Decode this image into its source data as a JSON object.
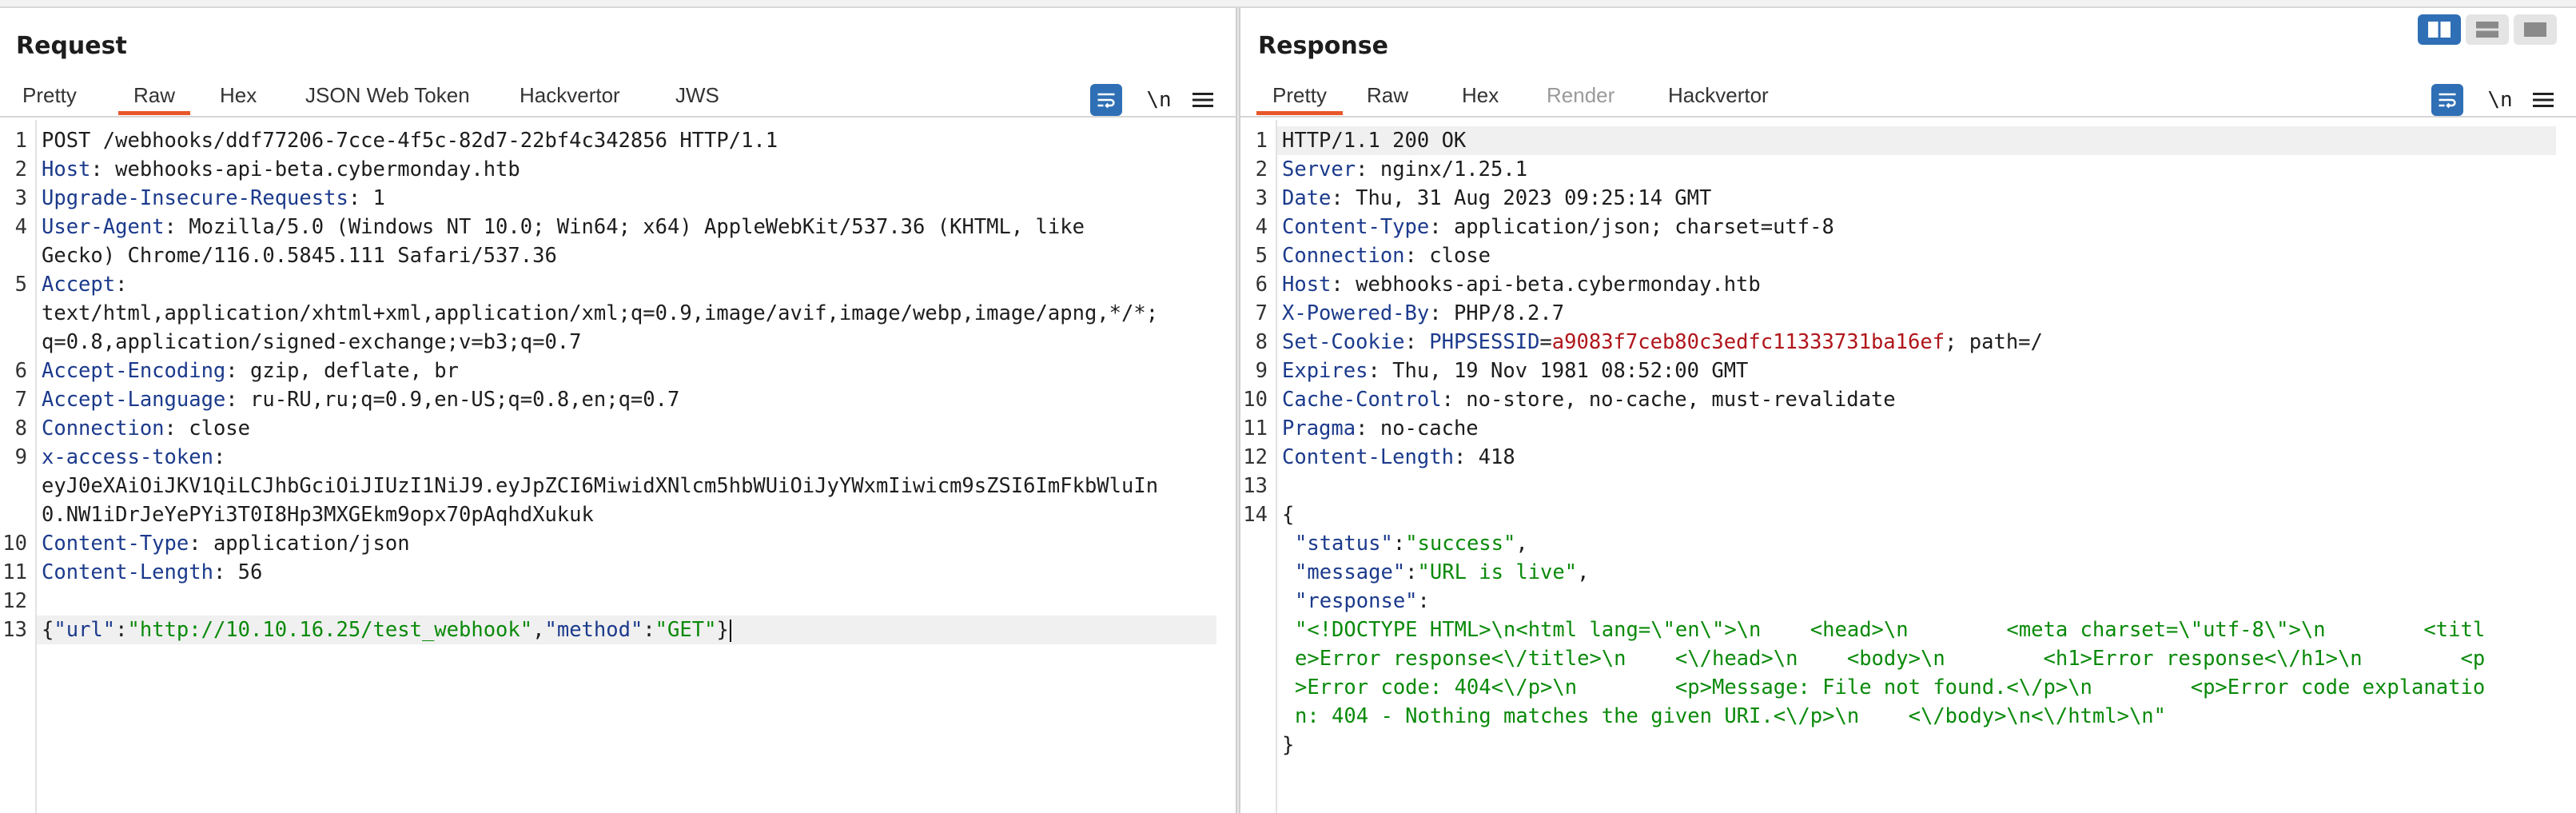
{
  "request": {
    "title": "Request",
    "tabs": [
      {
        "label": "Pretty",
        "active": false
      },
      {
        "label": "Raw",
        "active": true
      },
      {
        "label": "Hex",
        "active": false
      },
      {
        "label": "JSON Web Token",
        "active": false
      },
      {
        "label": "Hackvertor",
        "active": false
      },
      {
        "label": "JWS",
        "active": false
      }
    ],
    "newline_label": "\\n",
    "lines": [
      {
        "n": "1",
        "text": "POST /webhooks/ddf77206-7cce-4f5c-82d7-22bf4c342856 HTTP/1.1"
      },
      {
        "n": "2",
        "key": "Host",
        "value": " webhooks-api-beta.cybermonday.htb"
      },
      {
        "n": "3",
        "key": "Upgrade-Insecure-Requests",
        "value": " 1"
      },
      {
        "n": "4",
        "key": "User-Agent",
        "value": " Mozilla/5.0 (Windows NT 10.0; Win64; x64) AppleWebKit/537.36 (KHTML, like",
        "cont": "Gecko) Chrome/116.0.5845.111 Safari/537.36"
      },
      {
        "n": "5",
        "key": "Accept",
        "value": "",
        "cont": "text/html,application/xhtml+xml,application/xml;q=0.9,image/avif,image/webp,image/apng,*/*;",
        "cont2": "q=0.8,application/signed-exchange;v=b3;q=0.7"
      },
      {
        "n": "6",
        "key": "Accept-Encoding",
        "value": " gzip, deflate, br"
      },
      {
        "n": "7",
        "key": "Accept-Language",
        "value": " ru-RU,ru;q=0.9,en-US;q=0.8,en;q=0.7"
      },
      {
        "n": "8",
        "key": "Connection",
        "value": " close"
      },
      {
        "n": "9",
        "key": "x-access-token",
        "value": "",
        "cont": "eyJ0eXAiOiJKV1QiLCJhbGciOiJIUzI1NiJ9.eyJpZCI6MiwidXNlcm5hbWUiOiJyYWxmIiwicm9sZSI6ImFkbWluIn",
        "cont2": "0.NW1iDrJeYePYi3T0I8Hp3MXGEkm9opx70pAqhdXukuk"
      },
      {
        "n": "10",
        "key": "Content-Type",
        "value": " application/json"
      },
      {
        "n": "11",
        "key": "Content-Length",
        "value": " 56"
      },
      {
        "n": "12"
      },
      {
        "n": "13",
        "body": {
          "k1": "\"url\"",
          "v1": "\"http://10.10.16.25/test_webhook\"",
          "k2": "\"method\"",
          "v2": "\"GET\""
        }
      }
    ]
  },
  "response": {
    "title": "Response",
    "tabs": [
      {
        "label": "Pretty",
        "active": true
      },
      {
        "label": "Raw",
        "active": false
      },
      {
        "label": "Hex",
        "active": false
      },
      {
        "label": "Render",
        "active": false,
        "disabled": true
      },
      {
        "label": "Hackvertor",
        "active": false
      }
    ],
    "newline_label": "\\n",
    "lines": [
      {
        "n": "1",
        "text": "HTTP/1.1 200 OK"
      },
      {
        "n": "2",
        "key": "Server",
        "value": " nginx/1.25.1"
      },
      {
        "n": "3",
        "key": "Date",
        "value": " Thu, 31 Aug 2023 09:25:14 GMT"
      },
      {
        "n": "4",
        "key": "Content-Type",
        "value": " application/json; charset=utf-8"
      },
      {
        "n": "5",
        "key": "Connection",
        "value": " close"
      },
      {
        "n": "6",
        "key": "Host",
        "value": " webhooks-api-beta.cybermonday.htb"
      },
      {
        "n": "7",
        "key": "X-Powered-By",
        "value": " PHP/8.2.7"
      },
      {
        "n": "8",
        "key": "Set-Cookie",
        "cookie_name": "PHPSESSID",
        "cookie_value": "a9083f7ceb80c3edfc11333731ba16ef",
        "cookie_rest": "; path=/"
      },
      {
        "n": "9",
        "key": "Expires",
        "value": " Thu, 19 Nov 1981 08:52:00 GMT"
      },
      {
        "n": "10",
        "key": "Cache-Control",
        "value": " no-store, no-cache, must-revalidate"
      },
      {
        "n": "11",
        "key": "Pragma",
        "value": " no-cache"
      },
      {
        "n": "12",
        "key": "Content-Length",
        "value": " 418"
      },
      {
        "n": "13"
      },
      {
        "n": "14",
        "text": "{"
      }
    ],
    "json_body": {
      "status_key": "\"status\"",
      "status_val": "\"success\"",
      "message_key": "\"message\"",
      "message_val": "\"URL is live\"",
      "response_key": "\"response\"",
      "response_val_lines": [
        "\"<!DOCTYPE HTML>\\n<html lang=\\\"en\\\">\\n    <head>\\n        <meta charset=\\\"utf-8\\\">\\n        <titl",
        "e>Error response<\\/title>\\n    <\\/head>\\n    <body>\\n        <h1>Error response<\\/h1>\\n        <p",
        ">Error code: 404<\\/p>\\n        <p>Message: File not found.<\\/p>\\n        <p>Error code explanatio",
        "n: 404 - Nothing matches the given URI.<\\/p>\\n    <\\/body>\\n<\\/html>\\n\""
      ],
      "close": "}"
    }
  },
  "layout_buttons": [
    "split-horizontal",
    "split-vertical",
    "single"
  ]
}
